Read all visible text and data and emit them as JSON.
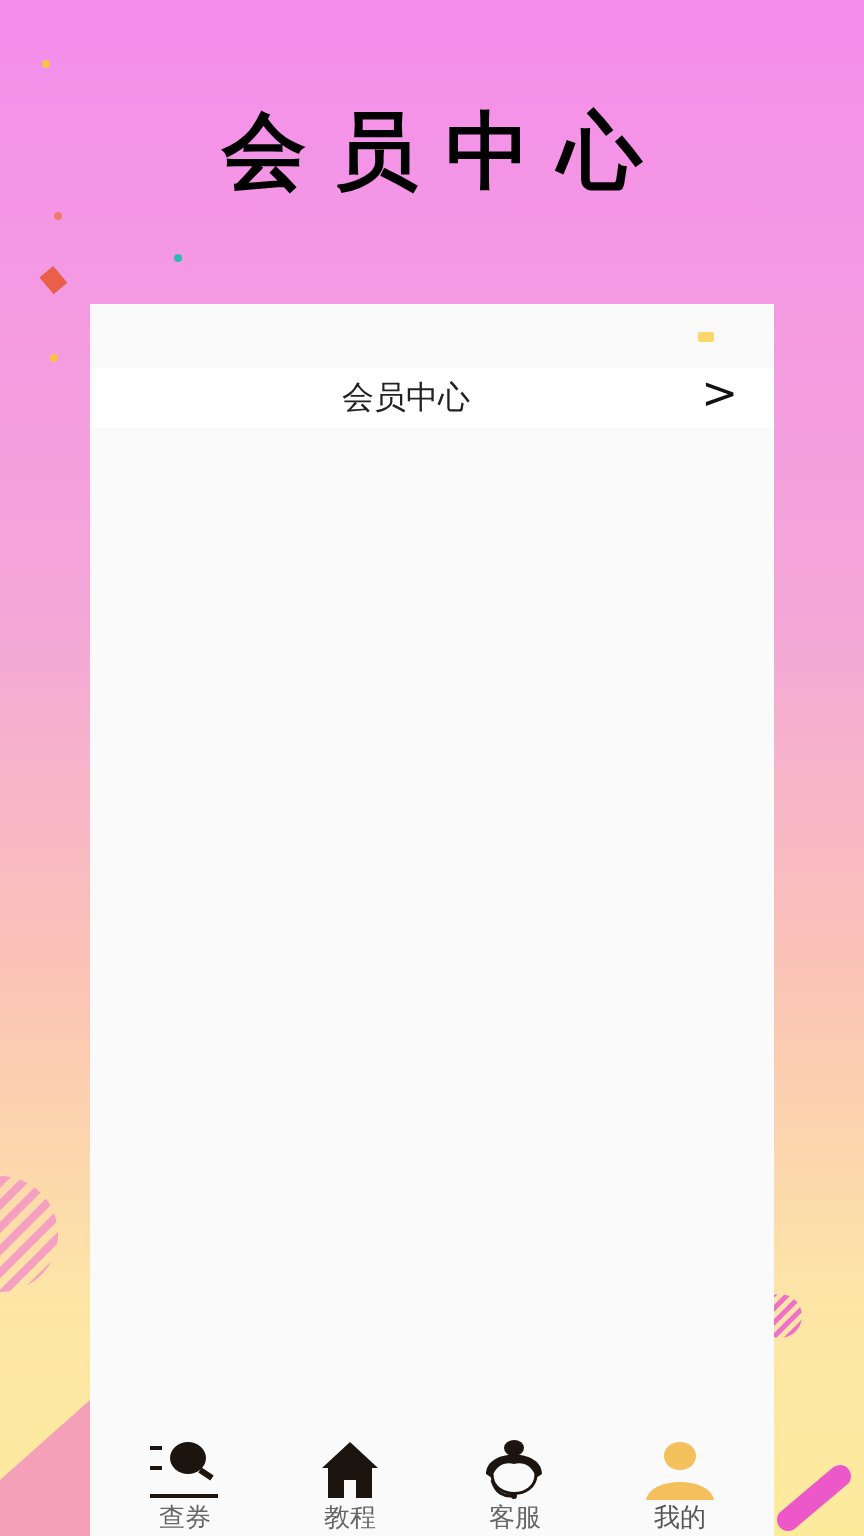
{
  "header": {
    "title": "会员中心"
  },
  "card": {
    "row": {
      "label": "会员中心",
      "chevron": ">"
    }
  },
  "tabs": [
    {
      "label": "查券",
      "kind": "search",
      "selected": false
    },
    {
      "label": "教程",
      "kind": "home",
      "selected": false
    },
    {
      "label": "客服",
      "kind": "support",
      "selected": false
    },
    {
      "label": "我的",
      "kind": "person",
      "selected": true
    }
  ]
}
